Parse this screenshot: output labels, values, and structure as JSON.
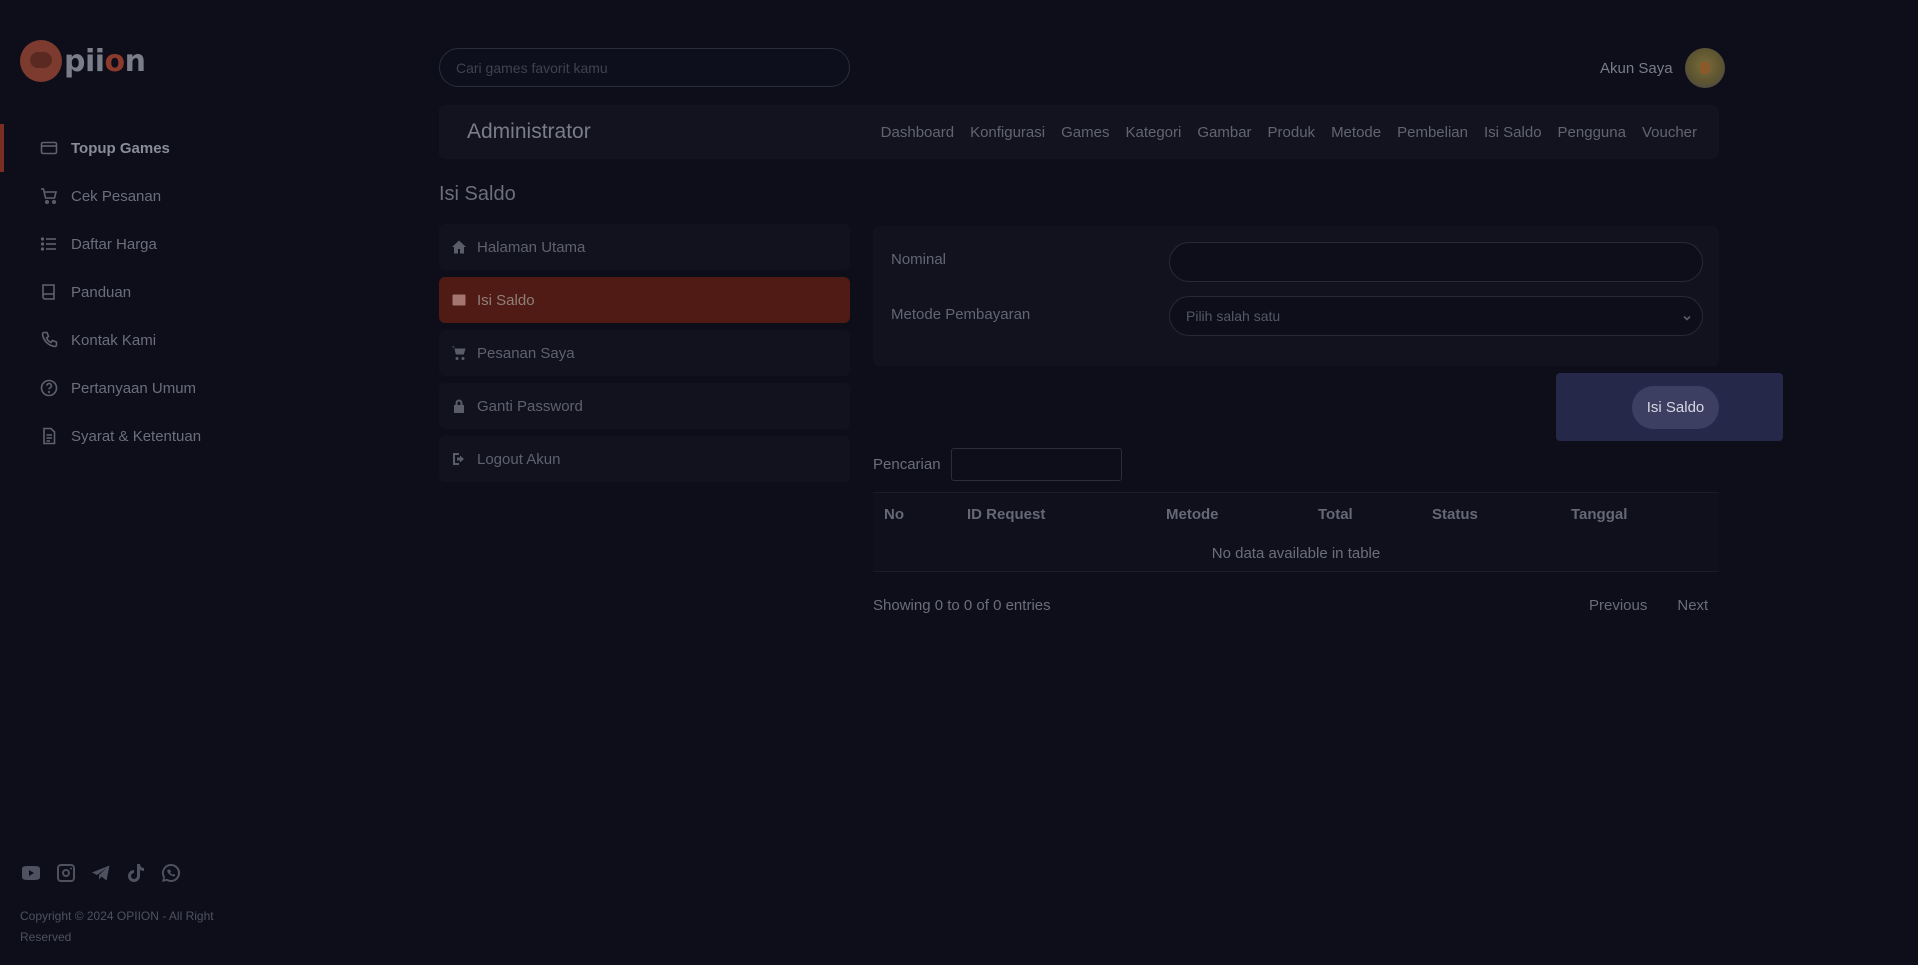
{
  "brand": {
    "name_prefix": "pii",
    "name_o": "o",
    "name_suffix": "n"
  },
  "sidebar": {
    "items": [
      {
        "label": "Topup Games",
        "icon": "card-icon",
        "active": true
      },
      {
        "label": "Cek Pesanan",
        "icon": "cart-icon"
      },
      {
        "label": "Daftar Harga",
        "icon": "list-icon"
      },
      {
        "label": "Panduan",
        "icon": "book-icon"
      },
      {
        "label": "Kontak Kami",
        "icon": "phone-icon"
      },
      {
        "label": "Pertanyaan Umum",
        "icon": "question-icon"
      },
      {
        "label": "Syarat & Ketentuan",
        "icon": "document-icon"
      }
    ],
    "socials": [
      "youtube-icon",
      "instagram-icon",
      "telegram-icon",
      "tiktok-icon",
      "whatsapp-icon"
    ],
    "copyright": "Copyright © 2024 OPIION - All Right Reserved"
  },
  "header": {
    "search_placeholder": "Cari games favorit kamu",
    "account_label": "Akun Saya"
  },
  "admin": {
    "title": "Administrator",
    "menu": [
      "Dashboard",
      "Konfigurasi",
      "Games",
      "Kategori",
      "Gambar",
      "Produk",
      "Metode",
      "Pembelian",
      "Isi Saldo",
      "Pengguna",
      "Voucher"
    ]
  },
  "page": {
    "title": "Isi Saldo"
  },
  "account_menu": [
    {
      "label": "Halaman Utama",
      "icon": "home-icon"
    },
    {
      "label": "Isi Saldo",
      "icon": "wallet-icon",
      "active": true
    },
    {
      "label": "Pesanan Saya",
      "icon": "cart-icon"
    },
    {
      "label": "Ganti Password",
      "icon": "lock-icon"
    },
    {
      "label": "Logout Akun",
      "icon": "logout-icon"
    }
  ],
  "form": {
    "nominal_label": "Nominal",
    "nominal_value": "",
    "method_label": "Metode Pembayaran",
    "method_selected": "Pilih salah satu",
    "submit_label": "Isi Saldo"
  },
  "table": {
    "search_label": "Pencarian",
    "columns": [
      "No",
      "ID Request",
      "Metode",
      "Total",
      "Status",
      "Tanggal"
    ],
    "empty_text": "No data available in table",
    "info": "Showing 0 to 0 of 0 entries",
    "prev_label": "Previous",
    "next_label": "Next"
  },
  "colors": {
    "background": "#0d0e1a",
    "accent": "#501b14",
    "modal": "#262849"
  }
}
